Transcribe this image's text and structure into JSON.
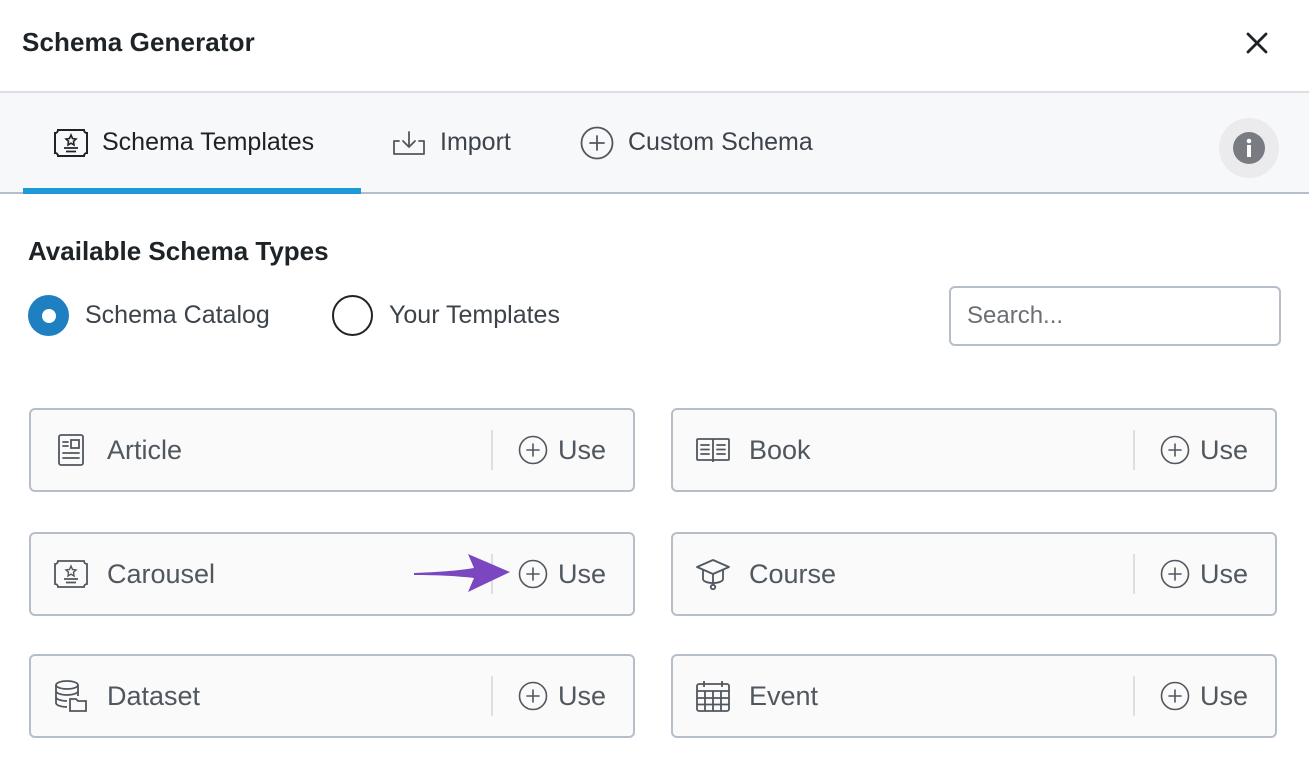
{
  "header": {
    "title": "Schema Generator",
    "close_icon": "close-icon"
  },
  "tabs": [
    {
      "label": "Schema Templates",
      "icon": "certificate-icon",
      "active": true
    },
    {
      "label": "Import",
      "icon": "import-icon",
      "active": false
    },
    {
      "label": "Custom Schema",
      "icon": "plus-circle-icon",
      "active": false
    }
  ],
  "info_icon": "info-icon",
  "section": {
    "title": "Available Schema Types",
    "radios": [
      {
        "label": "Schema Catalog",
        "selected": true
      },
      {
        "label": "Your Templates",
        "selected": false
      }
    ],
    "search": {
      "placeholder": "Search...",
      "value": ""
    }
  },
  "schema_types": [
    {
      "label": "Article",
      "icon": "article-icon",
      "action": "Use"
    },
    {
      "label": "Book",
      "icon": "book-icon",
      "action": "Use"
    },
    {
      "label": "Carousel",
      "icon": "certificate-icon",
      "action": "Use"
    },
    {
      "label": "Course",
      "icon": "graduation-cap-icon",
      "action": "Use"
    },
    {
      "label": "Dataset",
      "icon": "database-icon",
      "action": "Use"
    },
    {
      "label": "Event",
      "icon": "calendar-icon",
      "action": "Use"
    }
  ],
  "colors": {
    "accent": "#1e9bd7",
    "radio_selected": "#1e80c1",
    "annotation_arrow": "#7b47c1",
    "border": "#b6bec9",
    "text": "#50575e"
  }
}
